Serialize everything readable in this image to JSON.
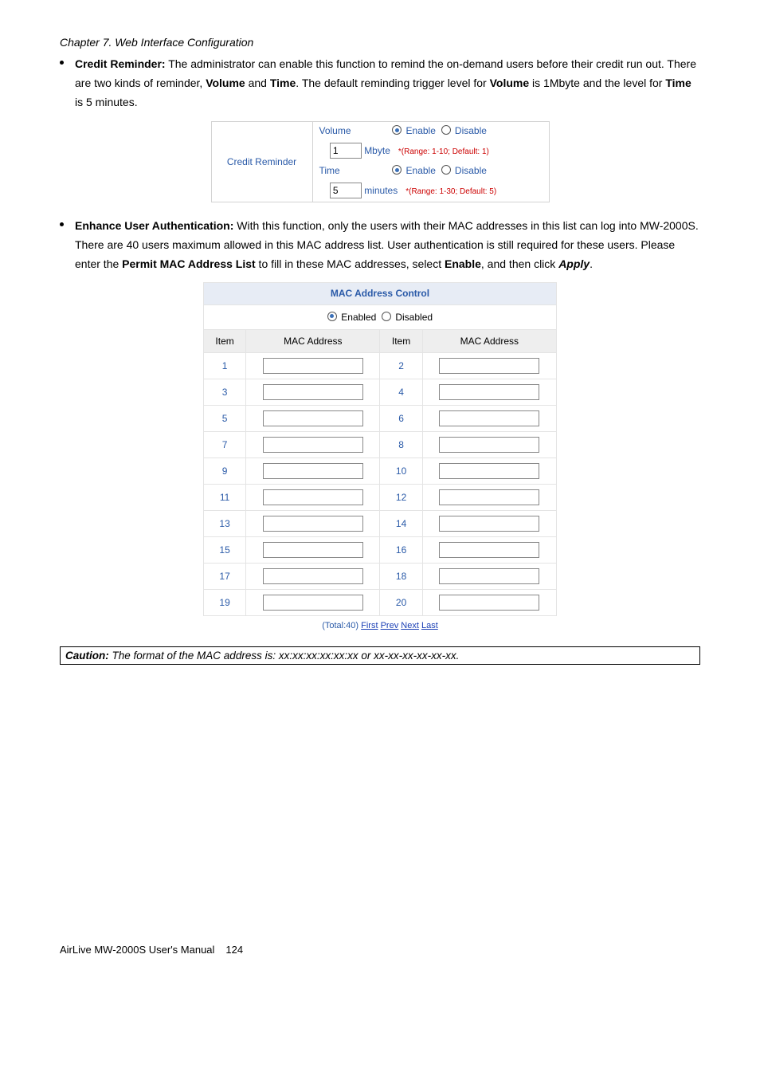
{
  "chapter": "Chapter 7.   Web Interface Configuration",
  "bullets": [
    {
      "lead": "Credit Reminder:",
      "body_segments": [
        " The administrator can enable this function to remind the on-demand users before their credit run out. There are two kinds of reminder, ",
        {
          "bold": "Volume"
        },
        " and ",
        {
          "bold": "Time"
        },
        ". The default reminding trigger level for ",
        {
          "bold": "Volume"
        },
        " is 1Mbyte and the level for ",
        {
          "bold": "Time"
        },
        " is 5 minutes."
      ]
    },
    {
      "lead": "Enhance User Authentication:",
      "body_segments": [
        " With this function, only the users with their MAC addresses in this list can log into MW-2000S. There are 40 users maximum allowed in this MAC address list. User authentication is still required for these users. Please enter the ",
        {
          "bold": "Permit MAC Address List"
        },
        " to fill in these MAC addresses, select ",
        {
          "bold": "Enable"
        },
        ", and then click ",
        {
          "bolditalic": "Apply"
        },
        "."
      ]
    }
  ],
  "credit": {
    "label": "Credit Reminder",
    "volume_label": "Volume",
    "enable": "Enable",
    "disable": "Disable",
    "mbyte": "Mbyte",
    "volume_val": "1",
    "volume_range": "*(Range: 1-10; Default: 1)",
    "time_label": "Time",
    "minutes": "minutes",
    "time_val": "5",
    "time_range": "*(Range: 1-30; Default: 5)"
  },
  "mac": {
    "title": "MAC Address Control",
    "enabled": "Enabled",
    "disabled": "Disabled",
    "col_item": "Item",
    "col_addr": "MAC Address",
    "rows": [
      [
        "1",
        "2"
      ],
      [
        "3",
        "4"
      ],
      [
        "5",
        "6"
      ],
      [
        "7",
        "8"
      ],
      [
        "9",
        "10"
      ],
      [
        "11",
        "12"
      ],
      [
        "13",
        "14"
      ],
      [
        "15",
        "16"
      ],
      [
        "17",
        "18"
      ],
      [
        "19",
        "20"
      ]
    ],
    "pager_total": "(Total:40)",
    "pager_links": [
      "First",
      "Prev",
      "Next",
      "Last"
    ]
  },
  "caution": {
    "lead": "Caution:",
    "text": " The format of the MAC address is: xx:xx:xx:xx:xx:xx or xx-xx-xx-xx-xx-xx."
  },
  "footer": {
    "left": "AirLive MW-2000S User's Manual",
    "page": "124"
  }
}
